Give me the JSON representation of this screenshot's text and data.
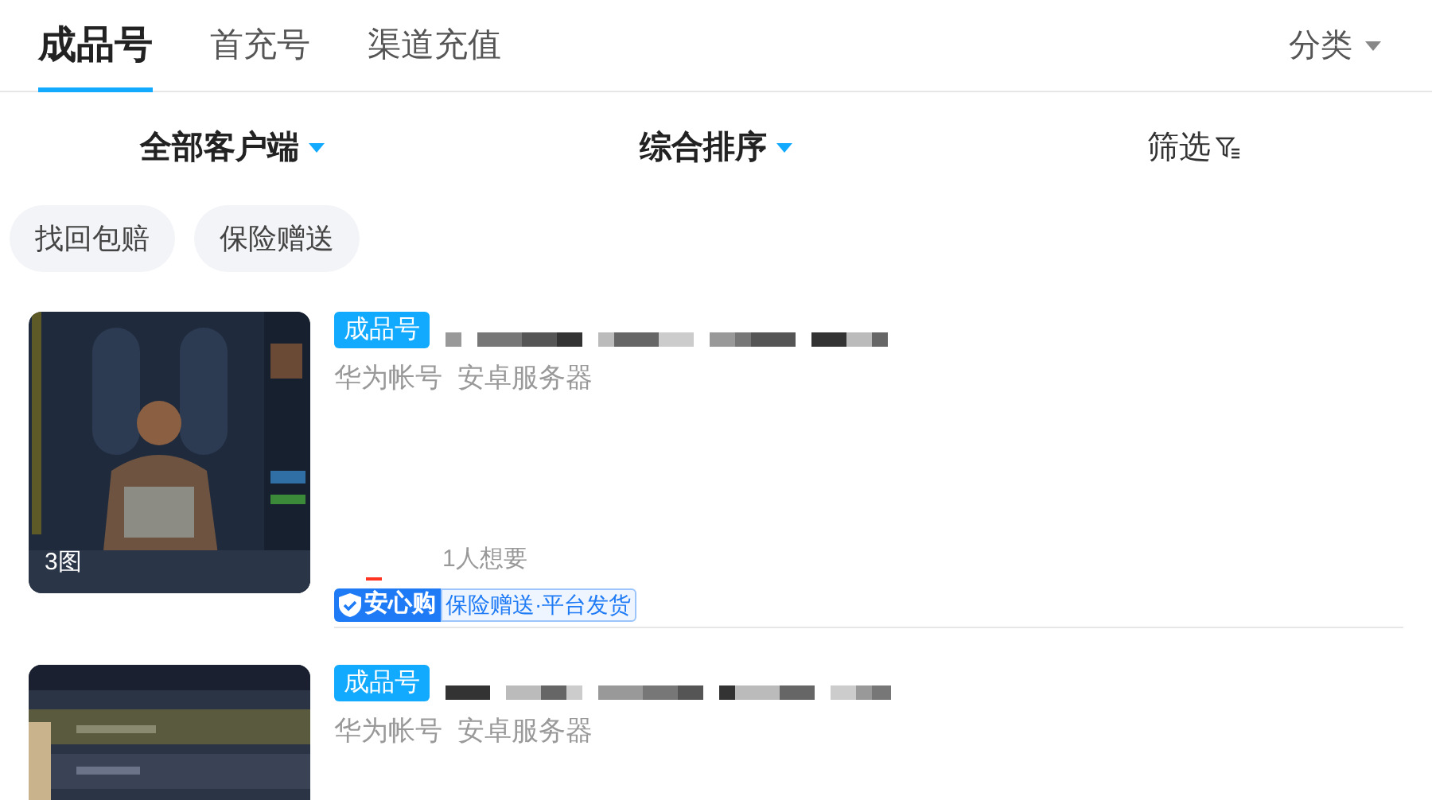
{
  "tabs": [
    {
      "label": "成品号",
      "selected": true
    },
    {
      "label": "首充号",
      "selected": false
    },
    {
      "label": "渠道充值",
      "selected": false
    }
  ],
  "category": {
    "label": "分类"
  },
  "filters": [
    {
      "label": "全部客户端",
      "kind": "dropdown"
    },
    {
      "label": "综合排序",
      "kind": "dropdown"
    },
    {
      "label": "筛选",
      "kind": "filter"
    }
  ],
  "chips": [
    "找回包赔",
    "保险赠送"
  ],
  "listings": [
    {
      "tag": "成品号",
      "subtitle": "华为帐号  安卓服务器",
      "photo_count": "3图",
      "wants": "1人想要",
      "badge": {
        "brand": "安心购",
        "text": "保险赠送·平台发货"
      }
    },
    {
      "tag": "成品号",
      "subtitle": "华为帐号  安卓服务器"
    }
  ]
}
